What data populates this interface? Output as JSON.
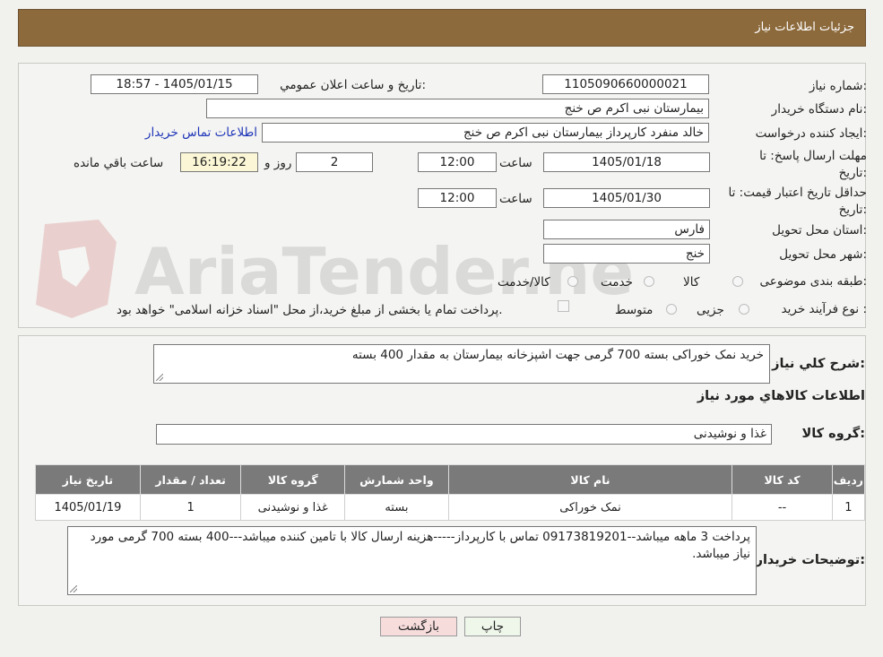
{
  "header": {
    "title": "جزئیات اطلاعات نیاز"
  },
  "watermark": {
    "text": "AriaTender.neT"
  },
  "form": {
    "need_number_label": "شماره نیاز:",
    "need_number": "1105090660000021",
    "announce_label": "تاریخ و ساعت اعلان عمومي:",
    "announce_value": "1405/01/15 - 18:57",
    "buyer_org_label": "نام دستگاه خريدار:",
    "buyer_org": "بیمارستان نبی اکرم  ص  خنج",
    "creator_label": "ايجاد كننده درخواست:",
    "creator": "خالد منفرد کارپرداز بیمارستان نبی اکرم  ص  خنج",
    "contact_link": "اطلاعات تماس خريدار",
    "reply_deadline_label": "مهلت ارسال پاسخ: تا تاريخ:",
    "reply_date": "1405/01/18",
    "time_label": "ساعت",
    "reply_time": "12:00",
    "days_value": "2",
    "days_label": "روز و",
    "remaining_time": "16:19:22",
    "remaining_label": "ساعت باقي مانده",
    "price_validity_label": "حداقل تاريخ اعتبار قيمت: تا تاريخ:",
    "price_date": "1405/01/30",
    "price_time": "12:00",
    "province_label": "استان محل تحويل:",
    "province": "فارس",
    "city_label": "شهر محل تحويل:",
    "city": "خنج",
    "category_label": "طبقه بندی موضوعی:",
    "category_options": [
      "کالا",
      "خدمت",
      "کالا/خدمت"
    ],
    "process_label": "نوع فرآیند خرید :",
    "process_options": [
      "جزیی",
      "متوسط"
    ],
    "payment_note": "پرداخت تمام یا بخشی از مبلغ خرید،از محل \"اسناد خزانه اسلامی\" خواهد بود."
  },
  "details": {
    "summary_label": "شرح کلي نياز:",
    "summary": "خرید نمک خوراکی بسته 700 گرمی جهت اشپزخانه بیمارستان به مقدار 400 بسته",
    "goods_info_title": "اطلاعات کالاهاي مورد نياز",
    "group_label": "گروه کالا:",
    "group_value": "غذا و نوشیدنی",
    "table": {
      "headers": [
        "رديف",
        "کد کالا",
        "نام کالا",
        "واحد شمارش",
        "گروه کالا",
        "تعداد / مقدار",
        "تاريخ نياز"
      ],
      "rows": [
        [
          "1",
          "--",
          "نمک خوراکی",
          "بسته",
          "غذا و نوشیدنی",
          "1",
          "1405/01/19"
        ]
      ]
    },
    "buyer_notes_label": "توضيحات خريدار:",
    "buyer_notes": "پرداخت 3 ماهه میباشد--09173819201 تماس با کارپرداز-----هزینه ارسال کالا با تامین کننده میباشد---400 بسته 700 گرمی مورد نیاز میباشد."
  },
  "buttons": {
    "print": "چاپ",
    "back": "بازگشت"
  }
}
